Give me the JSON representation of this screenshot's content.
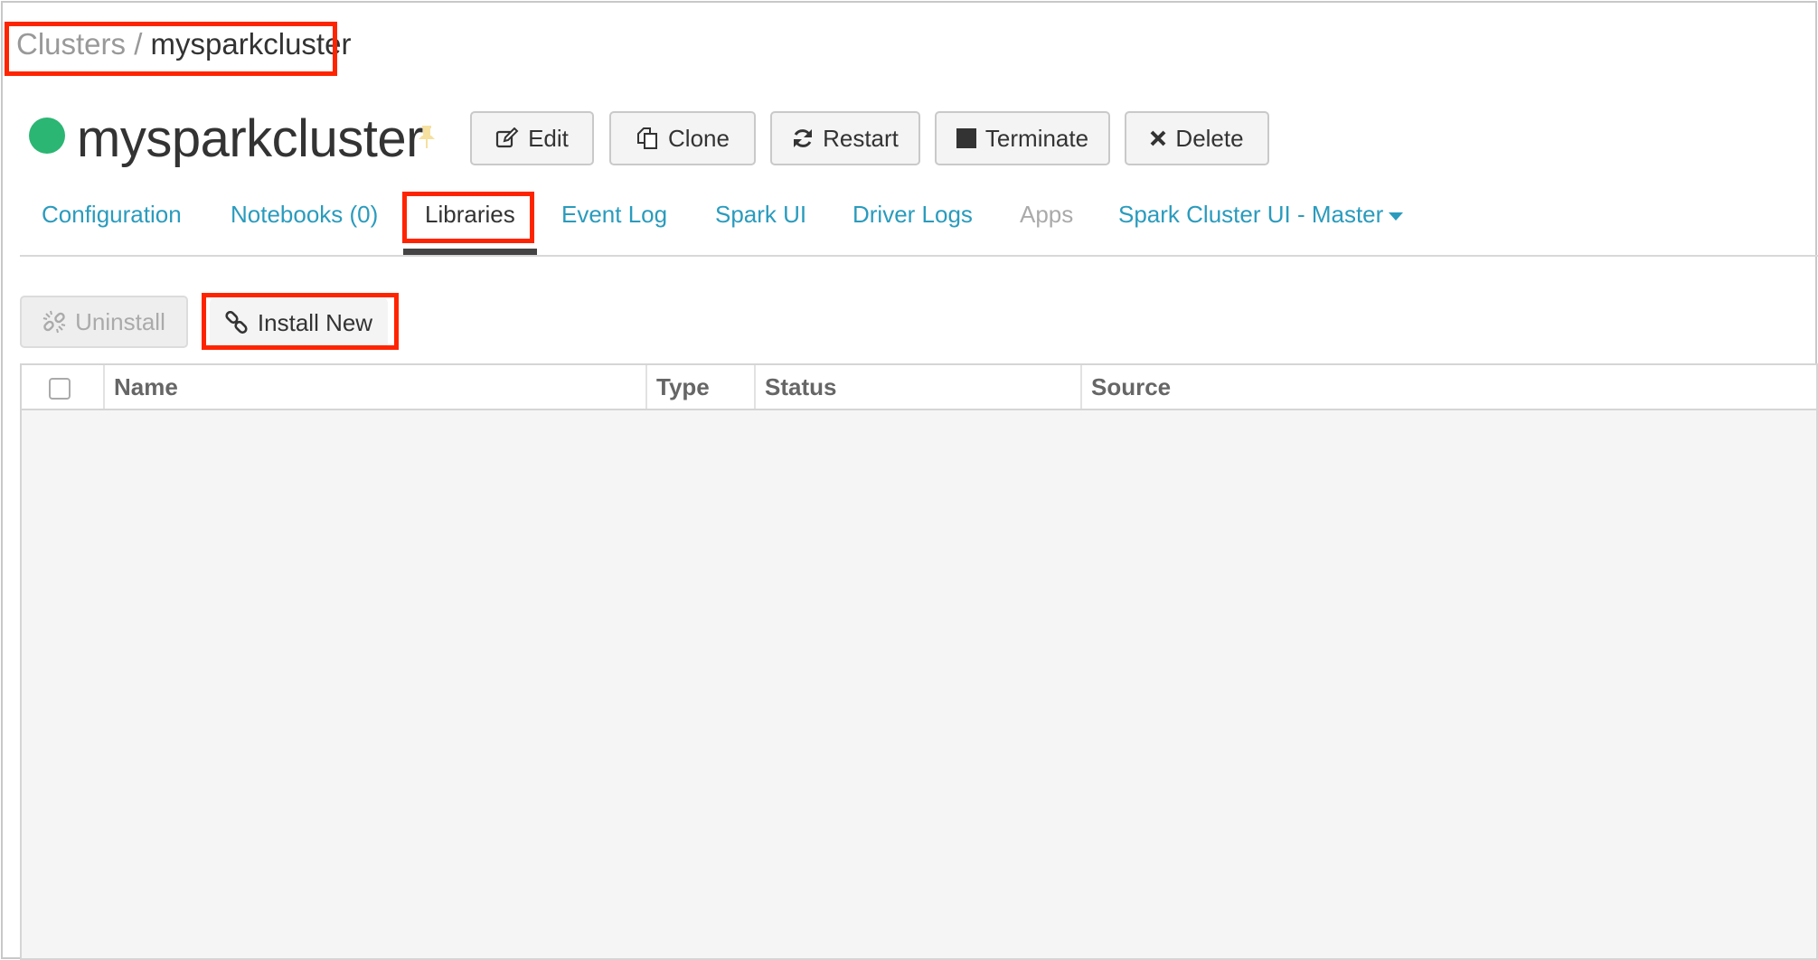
{
  "breadcrumb": {
    "parent": "Clusters",
    "separator": " / ",
    "current": "mysparkcluster"
  },
  "cluster": {
    "name": "mysparkcluster",
    "status_color": "#2bb673"
  },
  "actions": {
    "edit": "Edit",
    "clone": "Clone",
    "restart": "Restart",
    "terminate": "Terminate",
    "delete": "Delete"
  },
  "tabs": [
    {
      "label": "Configuration",
      "state": "link"
    },
    {
      "label": "Notebooks (0)",
      "state": "link"
    },
    {
      "label": "Libraries",
      "state": "active"
    },
    {
      "label": "Event Log",
      "state": "link"
    },
    {
      "label": "Spark UI",
      "state": "link"
    },
    {
      "label": "Driver Logs",
      "state": "link"
    },
    {
      "label": "Apps",
      "state": "disabled"
    },
    {
      "label": "Spark Cluster UI - Master",
      "state": "dropdown"
    }
  ],
  "library_actions": {
    "uninstall": "Uninstall",
    "install_new": "Install New"
  },
  "table": {
    "columns": [
      "Name",
      "Type",
      "Status",
      "Source"
    ],
    "rows": []
  },
  "colors": {
    "accent_link": "#2a9bbd",
    "highlight": "#ff2400",
    "running": "#2bb673"
  }
}
